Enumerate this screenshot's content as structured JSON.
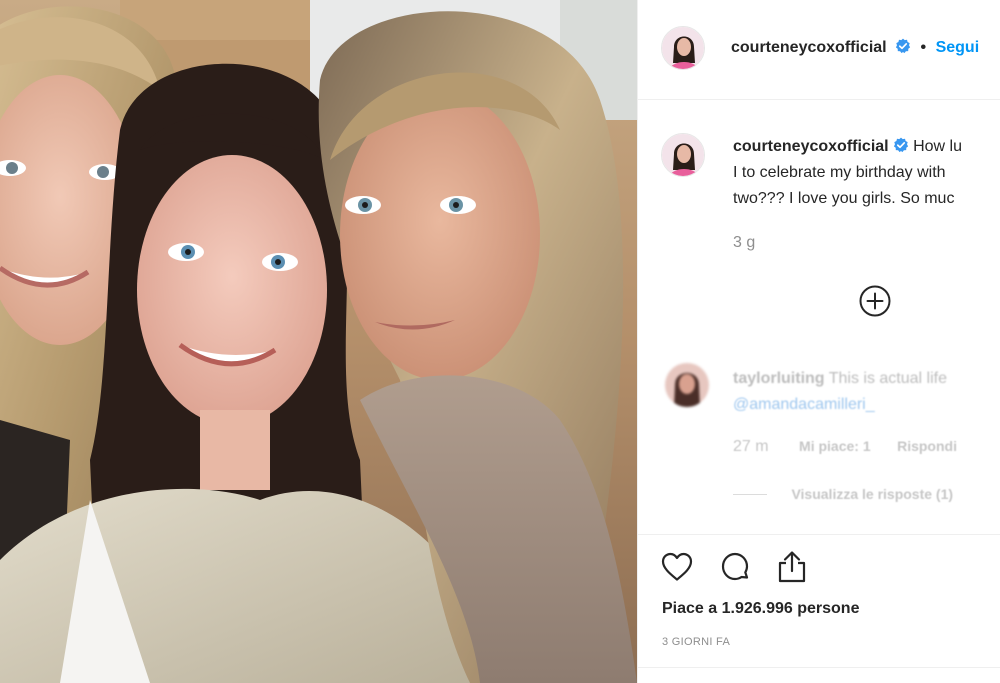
{
  "post": {
    "photo_alt": "Three women smiling in a selfie",
    "owner": {
      "username": "courteneycoxofficial",
      "verified": true,
      "separator": "•",
      "follow_label": "Segui"
    },
    "caption": {
      "username": "courteneycoxofficial",
      "lines": [
        "How lu",
        "I to celebrate my birthday with",
        "two??? I love you girls. So muc"
      ],
      "time": "3 g"
    },
    "load_more_icon": "plus-circle-icon",
    "comment": {
      "username": "taylorluiting",
      "text": "This is actual life",
      "mention": "@amandacamilleri_",
      "time": "27 m",
      "likes": "Mi piace: 1",
      "reply": "Rispondi",
      "view_replies": "Visualizza le risposte (1)"
    },
    "actions": {
      "like_icon": "heart-icon",
      "comment_icon": "comment-bubble-icon",
      "share_icon": "share-icon"
    },
    "likes_text": "Piace a 1.926.996 persone",
    "posted_ago": "3 GIORNI FA"
  },
  "colors": {
    "accent": "#0095f6",
    "verified": "#3897f0",
    "text": "#262626",
    "muted": "#8e8e8e",
    "border": "#efefef"
  }
}
